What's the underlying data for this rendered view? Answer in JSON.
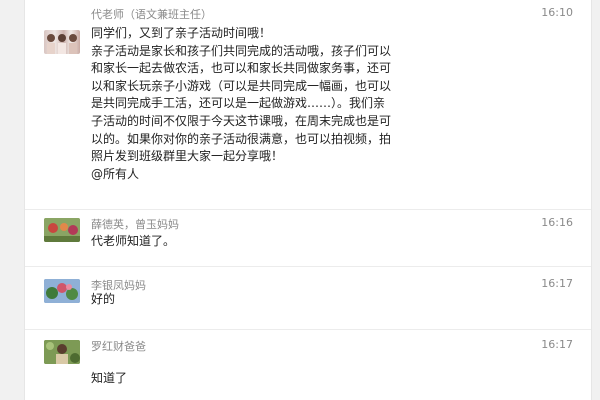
{
  "messages": [
    {
      "sender": "代老师（语文兼班主任）",
      "time": "16:10",
      "avatar_icon": "user-avatar-icon",
      "lines": [
        "同学们，又到了亲子活动时间哦！",
        "亲子活动是家长和孩子们共同完成的活动哦，孩子们可以",
        "和家长一起去做农活，也可以和家长共同做家务事，还可",
        "以和家长玩亲子小游戏（可以是共同完成一幅画，也可以",
        "是共同完成手工活，还可以是一起做游戏……）。我们亲",
        "子活动的时间不仅限于今天这节课哦，在周末完成也是可",
        "以的。如果你对你的亲子活动很满意，也可以拍视频，拍",
        "照片发到班级群里大家一起分享哦！",
        "@所有人"
      ]
    },
    {
      "sender": "薛德英，曾玉妈妈",
      "time": "16:16",
      "avatar_icon": "user-avatar-icon",
      "lines": [
        "代老师知道了。"
      ]
    },
    {
      "sender": "李银凤妈妈",
      "time": "16:17",
      "avatar_icon": "user-avatar-icon",
      "lines": [
        "好的"
      ]
    },
    {
      "sender": "罗红财爸爸",
      "time": "16:17",
      "avatar_icon": "user-avatar-icon",
      "lines": [
        "知道了"
      ]
    }
  ]
}
